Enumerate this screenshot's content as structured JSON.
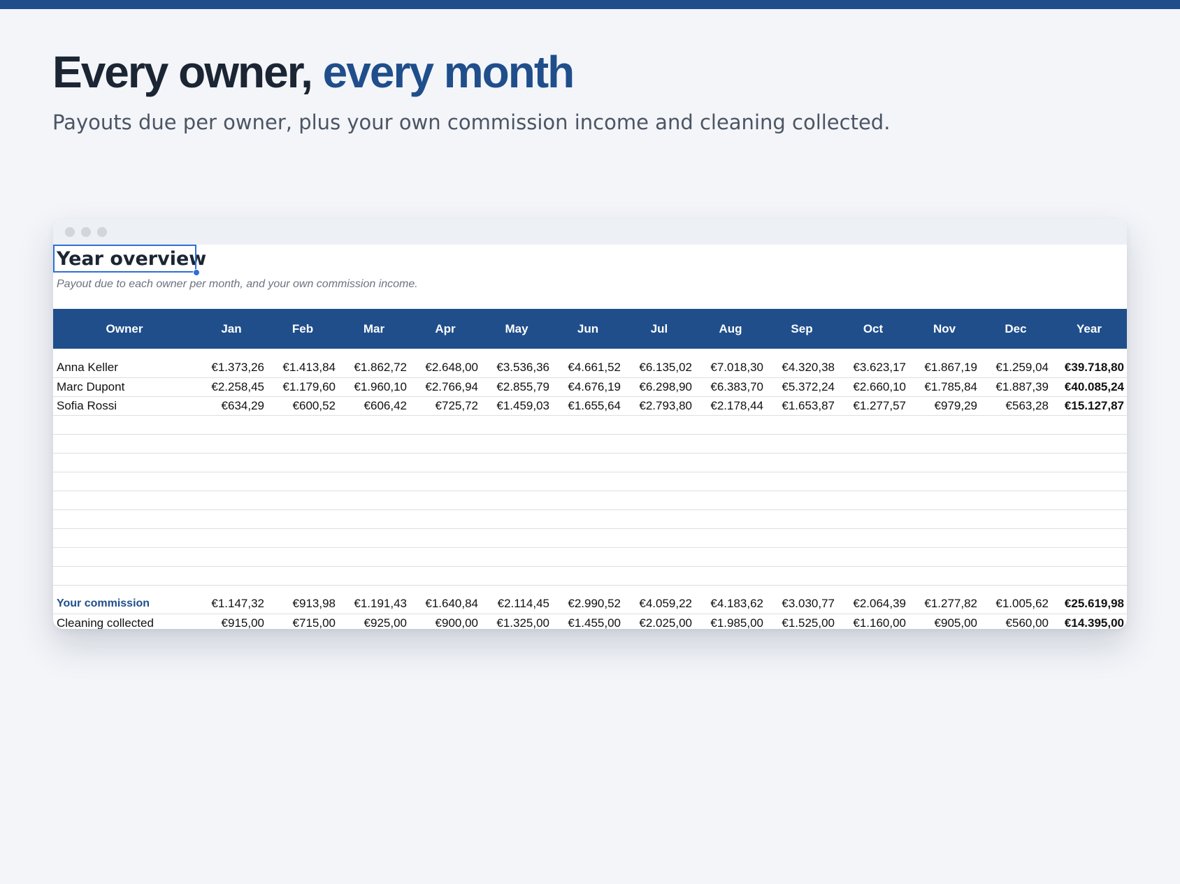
{
  "headline": {
    "main": "Every owner, ",
    "accent": "every month"
  },
  "subhead": "Payouts due per owner, plus your own commission income and cleaning collected.",
  "colors": {
    "brand": "#1f4e8b",
    "background": "#f3f5f9",
    "selection": "#2f6fd6"
  },
  "sheet": {
    "title": "Year overview",
    "subtitle": "Payout due to each owner per month, and your own commission income.",
    "columns": [
      "Owner",
      "Jan",
      "Feb",
      "Mar",
      "Apr",
      "May",
      "Jun",
      "Jul",
      "Aug",
      "Sep",
      "Oct",
      "Nov",
      "Dec",
      "Year"
    ],
    "owners": [
      {
        "name": "Anna Keller",
        "months": [
          "€1.373,26",
          "€1.413,84",
          "€1.862,72",
          "€2.648,00",
          "€3.536,36",
          "€4.661,52",
          "€6.135,02",
          "€7.018,30",
          "€4.320,38",
          "€3.623,17",
          "€1.867,19",
          "€1.259,04"
        ],
        "year": "€39.718,80"
      },
      {
        "name": "Marc Dupont",
        "months": [
          "€2.258,45",
          "€1.179,60",
          "€1.960,10",
          "€2.766,94",
          "€2.855,79",
          "€4.676,19",
          "€6.298,90",
          "€6.383,70",
          "€5.372,24",
          "€2.660,10",
          "€1.785,84",
          "€1.887,39"
        ],
        "year": "€40.085,24"
      },
      {
        "name": "Sofia Rossi",
        "months": [
          "€634,29",
          "€600,52",
          "€606,42",
          "€725,72",
          "€1.459,03",
          "€1.655,64",
          "€2.793,80",
          "€2.178,44",
          "€1.653,87",
          "€1.277,57",
          "€979,29",
          "€563,28"
        ],
        "year": "€15.127,87"
      }
    ],
    "commission": {
      "name": "Your commission",
      "months": [
        "€1.147,32",
        "€913,98",
        "€1.191,43",
        "€1.640,84",
        "€2.114,45",
        "€2.990,52",
        "€4.059,22",
        "€4.183,62",
        "€3.030,77",
        "€2.064,39",
        "€1.277,82",
        "€1.005,62"
      ],
      "year": "€25.619,98"
    },
    "cleaning": {
      "name": "Cleaning collected",
      "months": [
        "€915,00",
        "€715,00",
        "€925,00",
        "€900,00",
        "€1.325,00",
        "€1.455,00",
        "€2.025,00",
        "€1.985,00",
        "€1.525,00",
        "€1.160,00",
        "€905,00",
        "€560,00"
      ],
      "year": "€14.395,00"
    }
  }
}
